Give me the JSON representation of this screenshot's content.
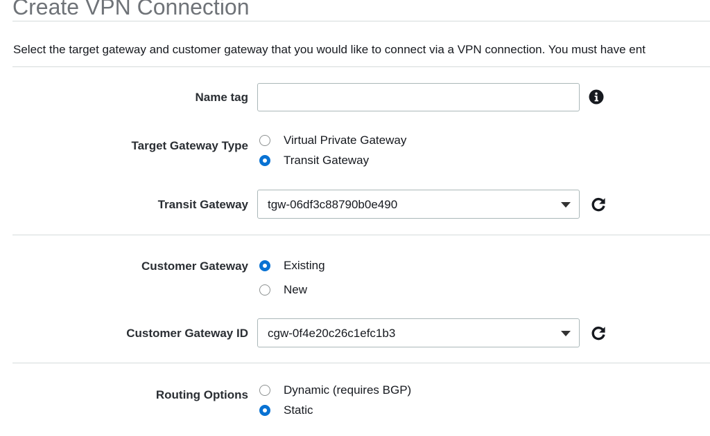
{
  "page": {
    "title": "Create VPN Connection",
    "intro": "Select the target gateway and customer gateway that you would like to connect via a VPN connection. You must have ent"
  },
  "form": {
    "name_tag": {
      "label": "Name tag",
      "value": "",
      "placeholder": ""
    },
    "target_gateway_type": {
      "label": "Target Gateway Type",
      "options": [
        "Virtual Private Gateway",
        "Transit Gateway"
      ],
      "selected": "Transit Gateway"
    },
    "transit_gateway": {
      "label": "Transit Gateway",
      "value": "tgw-06df3c88790b0e490"
    },
    "customer_gateway": {
      "label": "Customer Gateway",
      "options": [
        "Existing",
        "New"
      ],
      "selected": "Existing"
    },
    "customer_gateway_id": {
      "label": "Customer Gateway ID",
      "value": "cgw-0f4e20c26c1efc1b3"
    },
    "routing_options": {
      "label": "Routing Options",
      "options": [
        "Dynamic (requires BGP)",
        "Static"
      ],
      "selected": "Static"
    }
  },
  "icons": {
    "info": "info-icon",
    "refresh": "refresh-icon",
    "dropdown": "chevron-down-icon"
  },
  "colors": {
    "accent": "#0972d3",
    "title_gray": "#6f7378",
    "divider": "#d5dbdb",
    "input_border": "#aab7b8"
  }
}
